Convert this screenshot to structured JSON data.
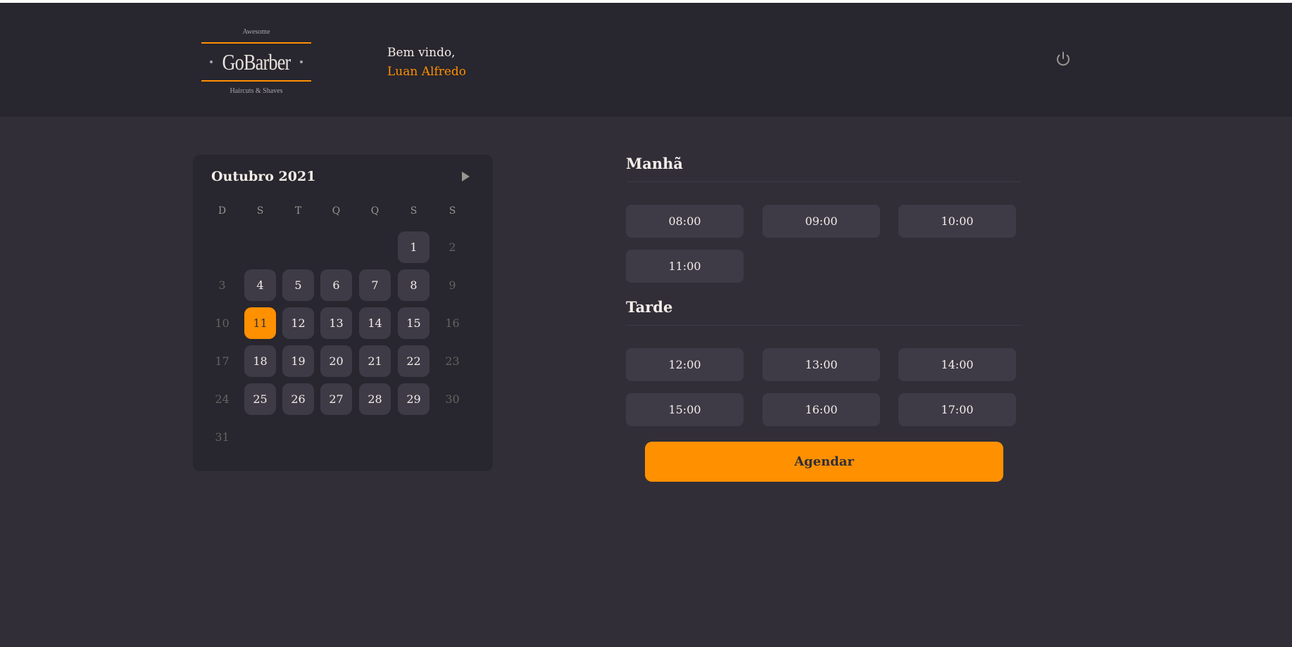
{
  "header": {
    "logo": {
      "top_text": "Awesome",
      "brand": "GoBarber",
      "bottom_text": "Haircuts & Shaves"
    },
    "greeting": "Bem vindo,",
    "user_name": "Luan Alfredo",
    "signout_icon": "power-icon"
  },
  "calendar": {
    "month_label": "Outubro 2021",
    "next_icon": "triangle-right-icon",
    "weekdays": [
      "D",
      "S",
      "T",
      "Q",
      "Q",
      "S",
      "S"
    ],
    "weeks": [
      [
        null,
        null,
        null,
        null,
        null,
        {
          "day": "1",
          "state": "available"
        },
        {
          "day": "2",
          "state": "disabled"
        }
      ],
      [
        {
          "day": "3",
          "state": "disabled"
        },
        {
          "day": "4",
          "state": "available"
        },
        {
          "day": "5",
          "state": "available"
        },
        {
          "day": "6",
          "state": "available"
        },
        {
          "day": "7",
          "state": "available"
        },
        {
          "day": "8",
          "state": "available"
        },
        {
          "day": "9",
          "state": "disabled"
        }
      ],
      [
        {
          "day": "10",
          "state": "disabled"
        },
        {
          "day": "11",
          "state": "selected"
        },
        {
          "day": "12",
          "state": "available"
        },
        {
          "day": "13",
          "state": "available"
        },
        {
          "day": "14",
          "state": "available"
        },
        {
          "day": "15",
          "state": "available"
        },
        {
          "day": "16",
          "state": "disabled"
        }
      ],
      [
        {
          "day": "17",
          "state": "disabled"
        },
        {
          "day": "18",
          "state": "available"
        },
        {
          "day": "19",
          "state": "available"
        },
        {
          "day": "20",
          "state": "available"
        },
        {
          "day": "21",
          "state": "available"
        },
        {
          "day": "22",
          "state": "available"
        },
        {
          "day": "23",
          "state": "disabled"
        }
      ],
      [
        {
          "day": "24",
          "state": "disabled"
        },
        {
          "day": "25",
          "state": "available"
        },
        {
          "day": "26",
          "state": "available"
        },
        {
          "day": "27",
          "state": "available"
        },
        {
          "day": "28",
          "state": "available"
        },
        {
          "day": "29",
          "state": "available"
        },
        {
          "day": "30",
          "state": "disabled"
        }
      ],
      [
        {
          "day": "31",
          "state": "disabled"
        },
        null,
        null,
        null,
        null,
        null,
        null
      ]
    ]
  },
  "schedule": {
    "morning": {
      "title": "Manhã",
      "slots": [
        "08:00",
        "09:00",
        "10:00",
        "11:00"
      ]
    },
    "afternoon": {
      "title": "Tarde",
      "slots": [
        "12:00",
        "13:00",
        "14:00",
        "15:00",
        "16:00",
        "17:00"
      ]
    },
    "submit_label": "Agendar"
  },
  "colors": {
    "accent": "#ff9000",
    "background": "#312e38",
    "header_bg": "#28262e",
    "card": "#3e3b47",
    "text": "#f4ede8",
    "muted": "#666360"
  }
}
